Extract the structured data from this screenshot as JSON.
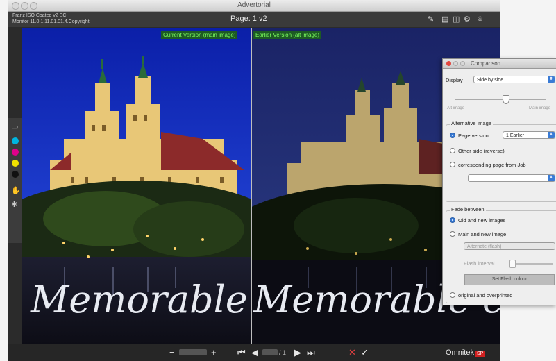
{
  "window": {
    "title": "Advertorial",
    "info_line1": "Franz ISO Coated v2 ECI",
    "info_line2": "Monitor 11.0.1.11.01.01.4.Copyright",
    "page_label": "Page: 1 v2"
  },
  "toolbar": {
    "icons": [
      "pen-icon",
      "layers-icon",
      "settings-icon",
      "users-icon"
    ]
  },
  "compare": {
    "left_label": "Current Version (main image)",
    "right_label": "Earlier Version (alt image)",
    "script_text_left": "Memorable eve",
    "script_text_right": "Memorable eve"
  },
  "left_strip": {
    "colors": {
      "cyan": "#00b6e0",
      "magenta": "#e0008a",
      "yellow": "#f0e000",
      "black": "#111111"
    }
  },
  "bottom": {
    "zoom_minus": "−",
    "zoom_plus": "+",
    "nav_first": "⏮",
    "nav_prev": "◀",
    "page_count": "/ 1",
    "nav_next": "▶",
    "nav_last": "⏭",
    "reject": "✕",
    "approve": "✓",
    "brand": "Omnitek",
    "brand_badge": "SP"
  },
  "panel": {
    "title": "Comparison",
    "display_label": "Display",
    "display_value": "Side by side",
    "slider_left": "Alt image",
    "slider_right": "Main image",
    "alt_group_title": "Alternative image",
    "alt_options": [
      {
        "label": "Page version",
        "selected": true
      },
      {
        "label": "Other side (reverse)",
        "selected": false
      },
      {
        "label": "corresponding page from Job",
        "selected": false
      }
    ],
    "page_version_value": "1 Earlier",
    "job_select_value": "",
    "fade_group_title": "Fade between",
    "fade_options": [
      {
        "label": "Old and new images",
        "selected": true
      },
      {
        "label": "Main and new image",
        "selected": false
      }
    ],
    "fade_mode_value": "Alternate (flash)",
    "flash_interval_label": "Flash interval",
    "flash_button_label": "Set Flash colour",
    "original_option_label": "original and overprinted"
  }
}
